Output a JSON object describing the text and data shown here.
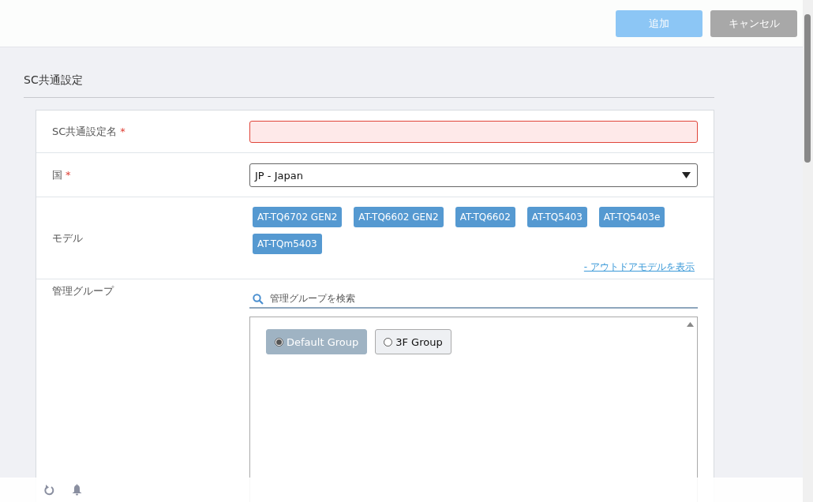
{
  "toolbar": {
    "buttons": [
      {
        "label": "追加",
        "kind": "primary",
        "disabled": true
      },
      {
        "label": "キャンセル",
        "kind": "secondary",
        "disabled": false
      }
    ]
  },
  "section_title": "SC共通設定",
  "form": {
    "name_field": {
      "label": "SC共通設定名",
      "required_mark": "*",
      "invalid": true
    },
    "country_field": {
      "label": "国",
      "required_mark": "*",
      "value": "JP - Japan"
    },
    "model_field": {
      "label": "モデル",
      "tags": [
        "AT-TQ6702 GEN2",
        "AT-TQ6602 GEN2",
        "AT-TQ6602",
        "AT-TQ5403",
        "AT-TQ5403e",
        "AT-TQm5403"
      ],
      "link": "- アウトドアモデルを表示"
    },
    "group_field": {
      "label": "管理グループ",
      "search_placeholder": "管理グループを検索",
      "groups": [
        {
          "label": "Default Group",
          "selected": true
        },
        {
          "label": "3F Group",
          "selected": false
        }
      ]
    }
  }
}
